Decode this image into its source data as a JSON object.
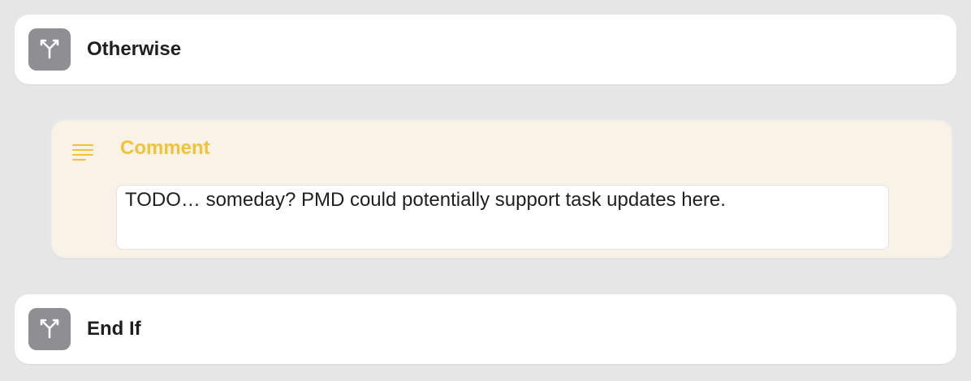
{
  "otherwise": {
    "title": "Otherwise",
    "icon": "branch-icon"
  },
  "comment": {
    "title": "Comment",
    "icon": "text-lines-icon",
    "text": "TODO… someday? PMD could potentially support task updates here.",
    "accent_color": "#f2c23a",
    "background_color": "#f8f3e6"
  },
  "end_if": {
    "title": "End If",
    "icon": "branch-icon"
  },
  "colors": {
    "page_background": "#e6e6e6",
    "icon_background": "#8e8e93"
  }
}
